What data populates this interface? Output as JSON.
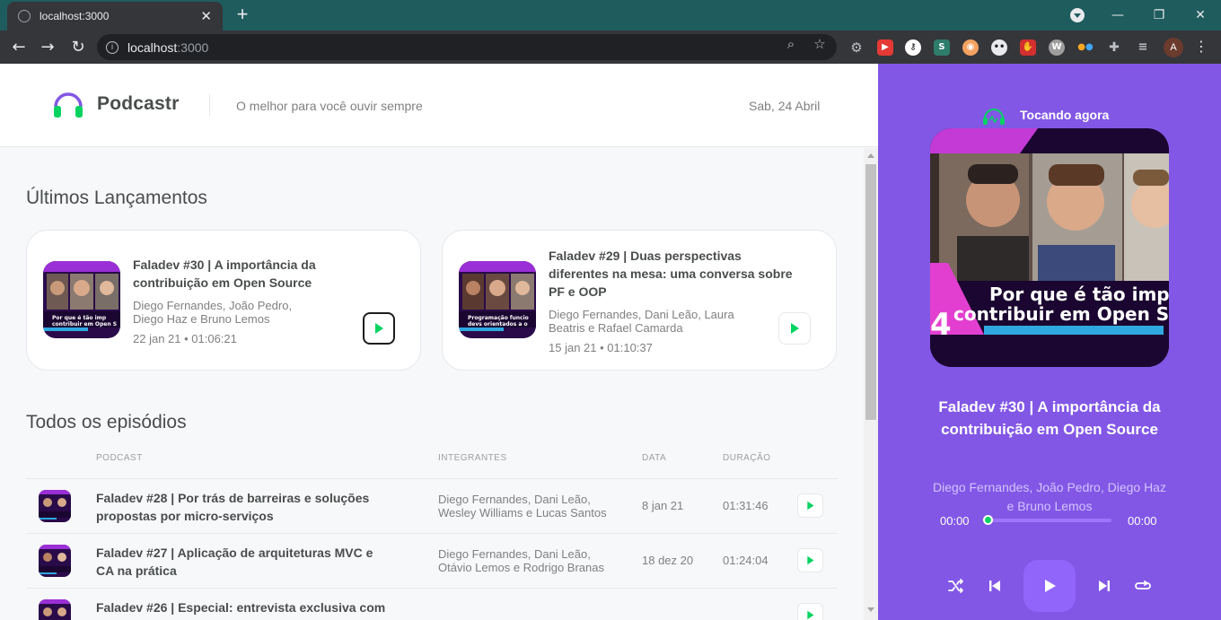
{
  "browser": {
    "tab_title": "localhost:3000",
    "url_host": "localhost",
    "url_port": ":3000",
    "avatar_letter": "A"
  },
  "header": {
    "brand": "Podcastr",
    "tagline": "O melhor para você ouvir sempre",
    "date": "Sab, 24 Abril"
  },
  "latest": {
    "title": "Últimos Lançamentos",
    "episodes": [
      {
        "title_line1": "Faladev #30 | A importância da",
        "title_line2": "contribuição em Open Source",
        "members_line1": "Diego Fernandes, João Pedro,",
        "members_line2": "Diego Haz e Bruno Lemos",
        "meta": "22 jan 21 • 01:06:21"
      },
      {
        "title_line1": "Faladev #29 | Duas perspectivas",
        "title_line2": "diferentes na mesa: uma conversa sobre",
        "title_line3": "PF e OOP",
        "members_line1": "Diego Fernandes, Dani Leão, Laura",
        "members_line2": "Beatris e Rafael Camarda",
        "meta": "15 jan 21 • 01:10:37"
      }
    ]
  },
  "all": {
    "title": "Todos os episódios",
    "columns": [
      "PODCAST",
      "INTEGRANTES",
      "DATA",
      "DURAÇÃO"
    ],
    "rows": [
      {
        "title_line1": "Faladev #28 | Por trás de barreiras e soluções",
        "title_line2": "propostas por micro-serviços",
        "members_line1": "Diego Fernandes, Dani Leão,",
        "members_line2": "Wesley Williams e Lucas Santos",
        "date": "8 jan 21",
        "duration": "01:31:46"
      },
      {
        "title_line1": "Faladev #27 | Aplicação de arquiteturas MVC e",
        "title_line2": "CA na prática",
        "members_line1": "Diego Fernandes, Dani Leão,",
        "members_line2": "Otávio Lemos e Rodrigo Branas",
        "date": "18 dez 20",
        "duration": "01:24:04"
      },
      {
        "title_line1": "Faladev #26 | Especial: entrevista exclusiva com",
        "title_line2": "",
        "members_line1": "",
        "members_line2": "",
        "date": "",
        "duration": ""
      }
    ]
  },
  "player": {
    "label": "Tocando agora",
    "cover_text_line1": "Por que é tão imp",
    "cover_text_line2": "contribuir em Open S",
    "cover_number": "4",
    "title": "Faladev #30 | A importância da contribuição em Open Source",
    "members": "Diego Fernandes, João Pedro, Diego Haz e Bruno Lemos",
    "time_current": "00:00",
    "time_total": "00:00",
    "progress_fraction": 0
  },
  "colors": {
    "accent": "#8257e5",
    "green": "#04d361"
  }
}
